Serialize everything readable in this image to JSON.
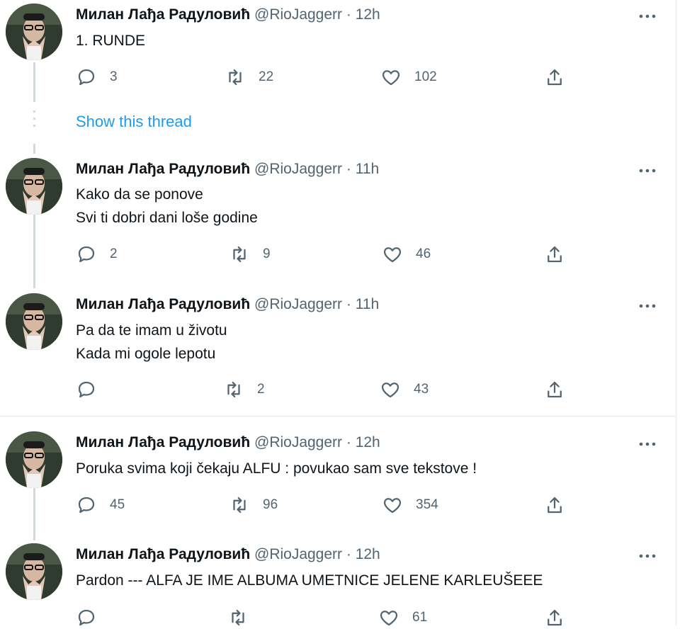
{
  "colors": {
    "accent": "#1d9bf0",
    "text": "#0f1419",
    "muted": "#536471",
    "thread_line": "#cfd9de"
  },
  "thread_link": "Show this thread",
  "tweets": [
    {
      "name": "Милан Лађа Радуловић",
      "handle": "@RioJaggerr",
      "time": "· 12h",
      "lines": [
        "1. RUNDE"
      ],
      "replies": "3",
      "retweets": "22",
      "likes": "102"
    },
    {
      "name": "Милан Лађа Радуловић",
      "handle": "@RioJaggerr",
      "time": "· 11h",
      "lines": [
        "Kako da se ponove",
        "Svi ti dobri dani loše godine"
      ],
      "replies": "2",
      "retweets": "9",
      "likes": "46"
    },
    {
      "name": "Милан Лађа Радуловић",
      "handle": "@RioJaggerr",
      "time": "· 11h",
      "lines": [
        "Pa da te imam u životu",
        "Kada mi ogole lepotu"
      ],
      "replies": "",
      "retweets": "2",
      "likes": "43"
    },
    {
      "name": "Милан Лађа Радуловић",
      "handle": "@RioJaggerr",
      "time": "· 12h",
      "lines": [
        "Poruka svima koji čekaju ALFU : povukao sam sve tekstove !"
      ],
      "replies": "45",
      "retweets": "96",
      "likes": "354"
    },
    {
      "name": "Милан Лађа Радуловић",
      "handle": "@RioJaggerr",
      "time": "· 12h",
      "lines": [
        "Pardon --- ALFA JE IME ALBUMA UMETNICE JELENE KARLEUŠEEE"
      ],
      "replies": "",
      "retweets": "",
      "likes": "61"
    }
  ]
}
